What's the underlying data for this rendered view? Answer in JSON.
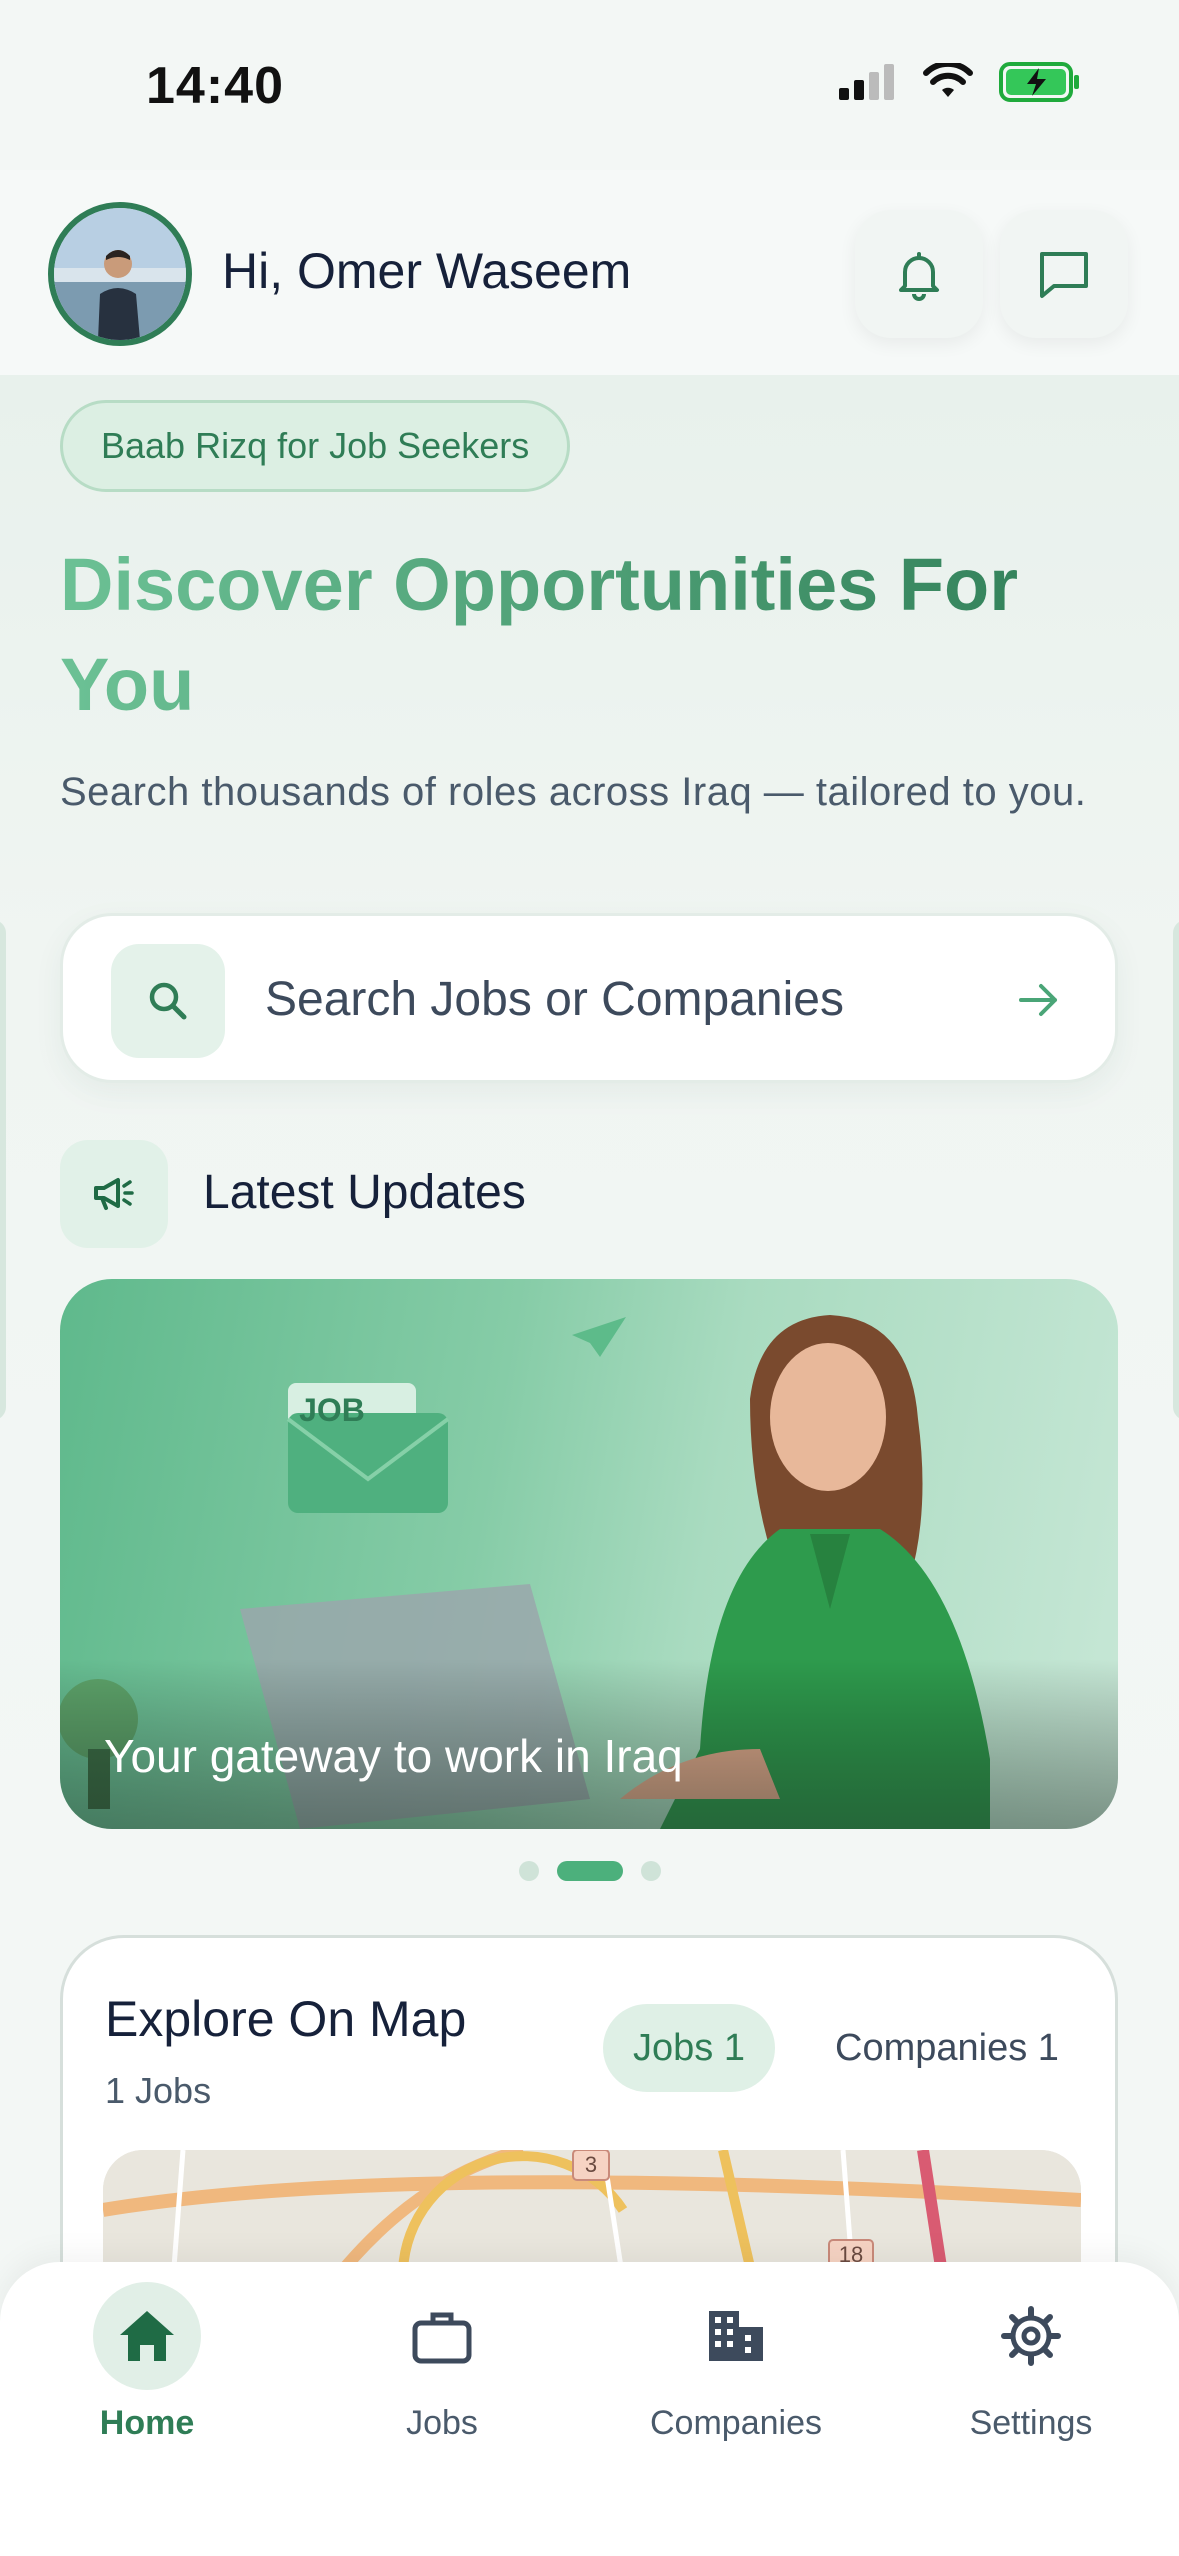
{
  "status_bar": {
    "time": "14:40",
    "icons": [
      "signal-icon",
      "wifi-icon",
      "battery-charging-icon"
    ]
  },
  "header": {
    "greeting": "Hi, Omer Waseem",
    "icons": [
      "bell-icon",
      "chat-icon"
    ]
  },
  "hero": {
    "tag": "Baab Rizq for Job Seekers",
    "title": "Discover Opportunities For You",
    "subtitle": "Search thousands of roles across Iraq — tailored to you."
  },
  "search": {
    "placeholder": "Search Jobs or Companies"
  },
  "updates": {
    "title": "Latest Updates"
  },
  "banner": {
    "caption": "Your gateway to work in Iraq",
    "envelope_label": "JOB",
    "active_slide": 2,
    "slide_count": 3
  },
  "map_section": {
    "title": "Explore On Map",
    "subtitle": "1 Jobs",
    "tabs": [
      {
        "label": "Jobs 1",
        "active": true
      },
      {
        "label": "Companies 1",
        "active": false
      }
    ],
    "markers": [
      "3",
      "18"
    ]
  },
  "bottom_nav": {
    "items": [
      {
        "label": "Home",
        "icon": "home-icon",
        "active": true
      },
      {
        "label": "Jobs",
        "icon": "briefcase-icon",
        "active": false
      },
      {
        "label": "Companies",
        "icon": "building-icon",
        "active": false
      },
      {
        "label": "Settings",
        "icon": "gear-icon",
        "active": false
      }
    ]
  },
  "colors": {
    "accent": "#2f7d56",
    "accent_light": "#6cc195",
    "background": "#f3f7f5"
  }
}
